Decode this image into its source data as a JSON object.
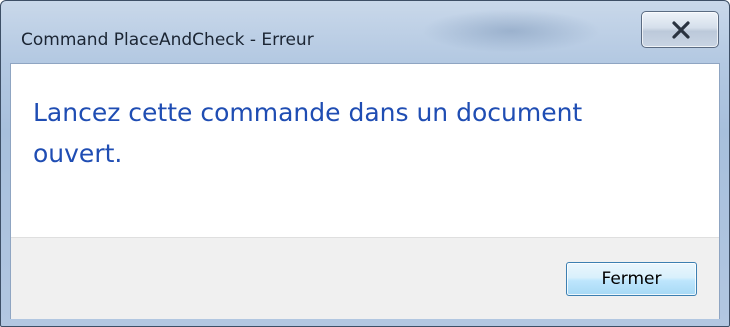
{
  "window": {
    "title": "Command PlaceAndCheck - Erreur",
    "close_icon": "close-x-icon"
  },
  "dialog": {
    "message": "Lancez cette commande dans un document ouvert.",
    "close_button_label": "Fermer"
  },
  "colors": {
    "message_text": "#1f4db3",
    "footer_background": "#f0f0f0",
    "titlebar": "#b4c9e2"
  }
}
